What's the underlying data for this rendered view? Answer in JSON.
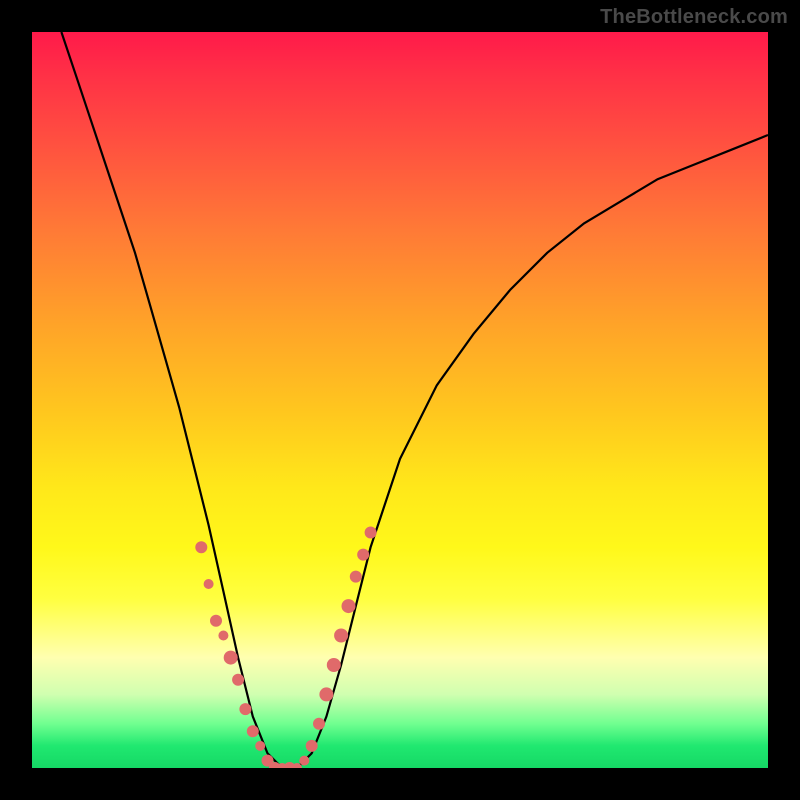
{
  "attribution": "TheBottleneck.com",
  "colors": {
    "curve": "#000000",
    "marker_fill": "#e06a6a",
    "marker_stroke": "#c84a4a",
    "background_black": "#000000"
  },
  "chart_data": {
    "type": "line",
    "title": "",
    "xlabel": "",
    "ylabel": "",
    "xlim": [
      0,
      100
    ],
    "ylim": [
      0,
      100
    ],
    "curve": {
      "description": "Bottleneck V-curve; y is approximate percentage (0 at green bottom, 100 at red top)",
      "x": [
        4,
        6,
        8,
        10,
        12,
        14,
        16,
        18,
        20,
        22,
        24,
        26,
        28,
        30,
        32,
        34,
        36,
        38,
        40,
        42,
        44,
        46,
        50,
        55,
        60,
        65,
        70,
        75,
        80,
        85,
        90,
        95,
        100
      ],
      "y": [
        100,
        94,
        88,
        82,
        76,
        70,
        63,
        56,
        49,
        41,
        33,
        24,
        15,
        7,
        2,
        0,
        0,
        2,
        7,
        14,
        22,
        30,
        42,
        52,
        59,
        65,
        70,
        74,
        77,
        80,
        82,
        84,
        86
      ]
    },
    "markers": {
      "description": "Highlighted sample points (pink beads) on both flanks and valley of the curve",
      "points": [
        {
          "x": 23,
          "y": 30,
          "r": 6
        },
        {
          "x": 24,
          "y": 25,
          "r": 5
        },
        {
          "x": 25,
          "y": 20,
          "r": 6
        },
        {
          "x": 26,
          "y": 18,
          "r": 5
        },
        {
          "x": 27,
          "y": 15,
          "r": 7
        },
        {
          "x": 28,
          "y": 12,
          "r": 6
        },
        {
          "x": 29,
          "y": 8,
          "r": 6
        },
        {
          "x": 30,
          "y": 5,
          "r": 6
        },
        {
          "x": 31,
          "y": 3,
          "r": 5
        },
        {
          "x": 32,
          "y": 1,
          "r": 6
        },
        {
          "x": 33,
          "y": 0,
          "r": 6
        },
        {
          "x": 34,
          "y": 0,
          "r": 5
        },
        {
          "x": 35,
          "y": 0,
          "r": 6
        },
        {
          "x": 36,
          "y": 0,
          "r": 5
        },
        {
          "x": 37,
          "y": 1,
          "r": 5
        },
        {
          "x": 38,
          "y": 3,
          "r": 6
        },
        {
          "x": 39,
          "y": 6,
          "r": 6
        },
        {
          "x": 40,
          "y": 10,
          "r": 7
        },
        {
          "x": 41,
          "y": 14,
          "r": 7
        },
        {
          "x": 42,
          "y": 18,
          "r": 7
        },
        {
          "x": 43,
          "y": 22,
          "r": 7
        },
        {
          "x": 44,
          "y": 26,
          "r": 6
        },
        {
          "x": 45,
          "y": 29,
          "r": 6
        },
        {
          "x": 46,
          "y": 32,
          "r": 6
        }
      ]
    }
  }
}
